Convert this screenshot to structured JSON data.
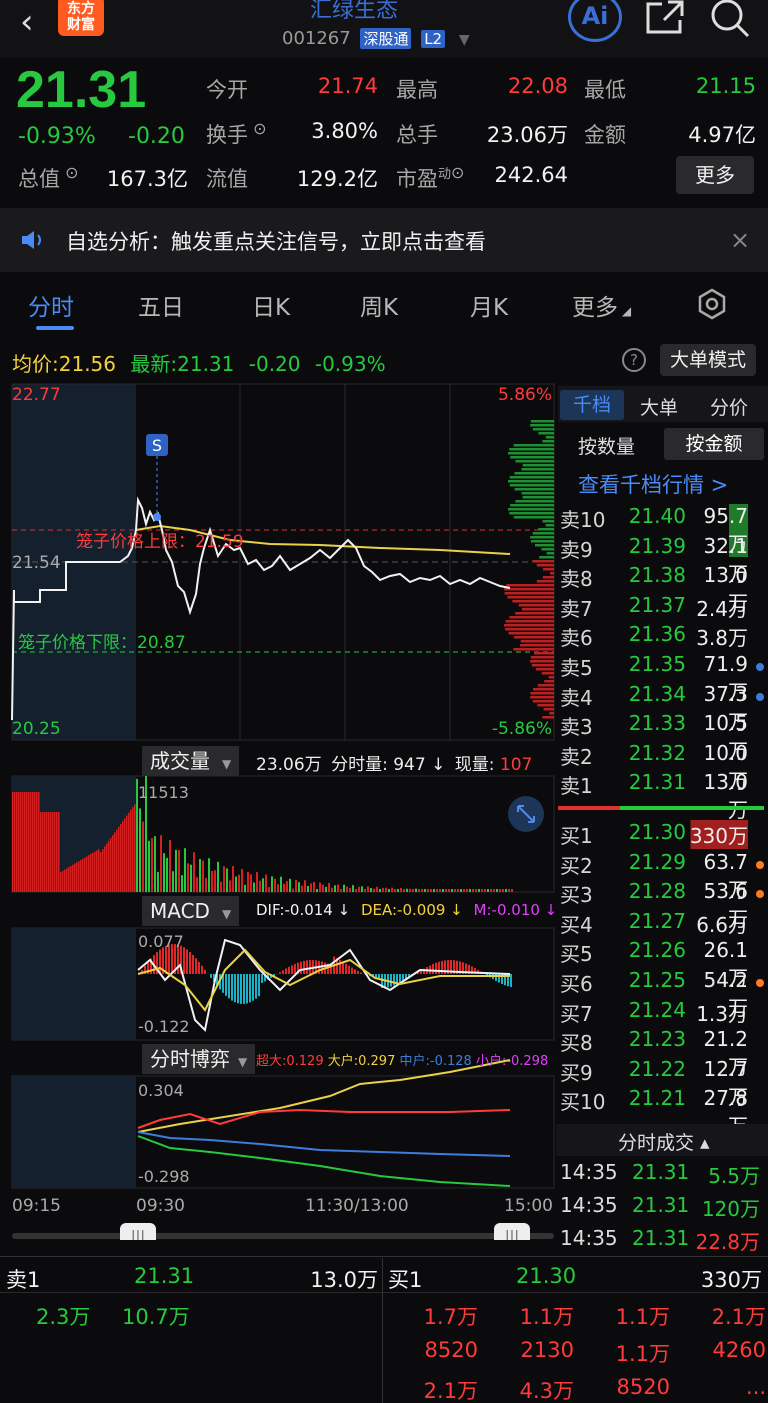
{
  "header": {
    "back": "‹",
    "logo_line1": "东方",
    "logo_line2": "财富",
    "stock_name": "汇绿生态",
    "stock_code": "001267",
    "tag_sgt": "深股通",
    "tag_l2": "L2",
    "ai": "Ai"
  },
  "quote": {
    "price": "21.31",
    "pct": "-0.93%",
    "chg": "-0.20",
    "open_label": "今开",
    "open": "21.74",
    "high_label": "最高",
    "high": "22.08",
    "low_label": "最低",
    "low": "21.15",
    "turnover_label": "换手",
    "turnover": "3.80%",
    "volume_label": "总手",
    "volume": "23.06万",
    "amount_label": "金额",
    "amount": "4.97亿",
    "mktcap_label": "总值",
    "mktcap": "167.3亿",
    "float_label": "流值",
    "float": "129.2亿",
    "pe_label": "市盈",
    "pe_sup": "动",
    "pe": "242.64",
    "more": "更多"
  },
  "notice": {
    "text": "自选分析：触发重点关注信号，立即点击查看",
    "close": "×"
  },
  "tabs": [
    "分时",
    "五日",
    "日K",
    "周K",
    "月K",
    "更多"
  ],
  "info": {
    "avg_label": "均价:",
    "avg": "21.56",
    "last_label": "最新:",
    "last": "21.31",
    "chg": "-0.20",
    "pct": "-0.93%",
    "help": "?",
    "bigorder_mode": "大单模式"
  },
  "price_chart": {
    "y_top": "22.77",
    "y_mid": "21.54",
    "y_bottom": "20.25",
    "pct_top": "5.86%",
    "pct_bottom": "-5.86%",
    "upper_limit_label": "笼子价格上限：21.59",
    "lower_limit_label": "笼子价格下限：20.87",
    "signal": "S"
  },
  "volume_panel": {
    "label": "成交量",
    "total": "23.06万",
    "period_label": "分时量:",
    "period": "947",
    "now_label": "现量:",
    "now": "107",
    "max": "11513"
  },
  "macd_panel": {
    "label": "MACD",
    "dif": "DIF:-0.014 ↓",
    "dea": "DEA:-0.009 ↓",
    "m": "M:-0.010 ↓",
    "top": "0.077",
    "bottom": "-0.122"
  },
  "game_panel": {
    "label": "分时博弈",
    "super": "超大:0.129",
    "big": "大户:0.297",
    "mid": "中户:-0.128",
    "small": "小户:-0.298",
    "top": "0.304",
    "bottom": "-0.298"
  },
  "time_axis": [
    "09:15",
    "09:30",
    "11:30/13:00",
    "15:00"
  ],
  "orderbook": {
    "tabs": [
      "千档",
      "大单",
      "分价"
    ],
    "subtabs": [
      "按数量",
      "按金额"
    ],
    "view_link": "查看千档行情 >",
    "asks": [
      {
        "side": "卖10",
        "price": "21.40",
        "vol": "95.7万"
      },
      {
        "side": "卖9",
        "price": "21.39",
        "vol": "32.1万"
      },
      {
        "side": "卖8",
        "price": "21.38",
        "vol": "13.0万"
      },
      {
        "side": "卖7",
        "price": "21.37",
        "vol": "2.4万"
      },
      {
        "side": "卖6",
        "price": "21.36",
        "vol": "3.8万"
      },
      {
        "side": "卖5",
        "price": "21.35",
        "vol": "71.9万"
      },
      {
        "side": "卖4",
        "price": "21.34",
        "vol": "37.3万"
      },
      {
        "side": "卖3",
        "price": "21.33",
        "vol": "10.5万"
      },
      {
        "side": "卖2",
        "price": "21.32",
        "vol": "10.0万"
      },
      {
        "side": "卖1",
        "price": "21.31",
        "vol": "13.0万"
      }
    ],
    "bids": [
      {
        "side": "买1",
        "price": "21.30",
        "vol": "330万"
      },
      {
        "side": "买2",
        "price": "21.29",
        "vol": "63.7万"
      },
      {
        "side": "买3",
        "price": "21.28",
        "vol": "53.6万"
      },
      {
        "side": "买4",
        "price": "21.27",
        "vol": "6.6万"
      },
      {
        "side": "买5",
        "price": "21.26",
        "vol": "26.1万"
      },
      {
        "side": "买6",
        "price": "21.25",
        "vol": "54.2万"
      },
      {
        "side": "买7",
        "price": "21.24",
        "vol": "1.3万"
      },
      {
        "side": "买8",
        "price": "21.23",
        "vol": "21.2万"
      },
      {
        "side": "买9",
        "price": "21.22",
        "vol": "12.7万"
      },
      {
        "side": "买10",
        "price": "21.21",
        "vol": "27.8万"
      }
    ],
    "ticks_label": "分时成交 ▴",
    "ticks": [
      {
        "time": "14:35",
        "price": "21.31",
        "vol": "5.5万"
      },
      {
        "time": "14:35",
        "price": "21.31",
        "vol": "120万"
      },
      {
        "time": "14:35",
        "price": "21.31",
        "vol": "22.8万"
      }
    ]
  },
  "bottom": {
    "sell_label": "卖1",
    "sell_price": "21.31",
    "sell_vol": "13.0万",
    "buy_label": "买1",
    "buy_price": "21.30",
    "buy_vol": "330万",
    "sell_queue": [
      "2.3万",
      "10.7万"
    ],
    "buy_queue": [
      "1.7万",
      "1.1万",
      "1.1万",
      "2.1万",
      "8520",
      "2130",
      "1.1万",
      "4260",
      "2.1万",
      "4.3万",
      "8520",
      "..."
    ]
  },
  "colors": {
    "up": "#ff3b3b",
    "down": "#27c93f",
    "accent": "#4a8bf5",
    "avg_line": "#f4d23c"
  }
}
